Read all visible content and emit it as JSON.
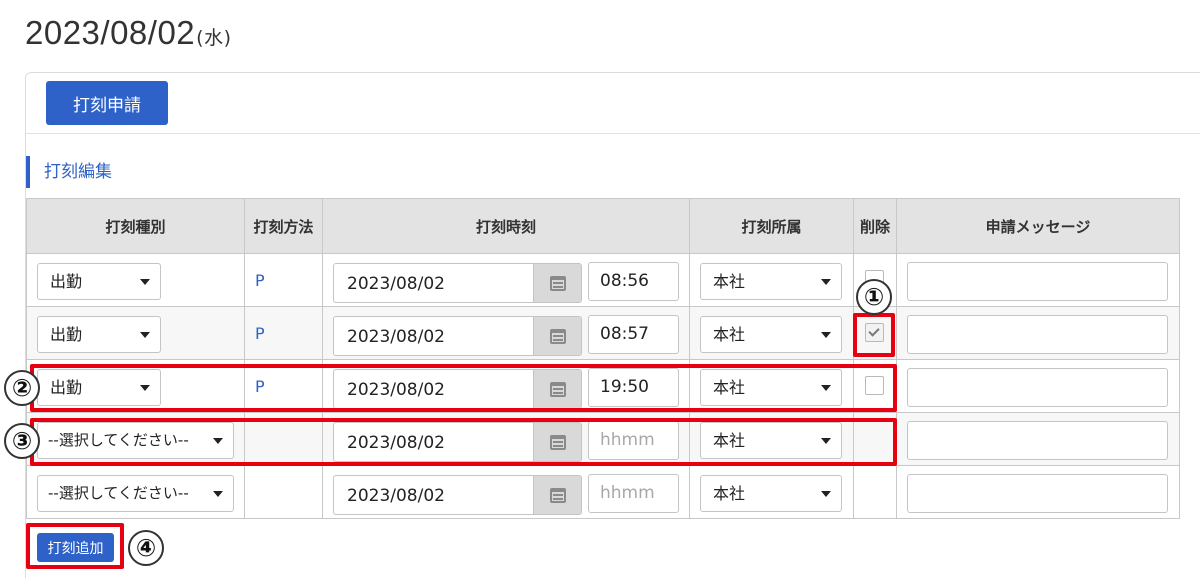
{
  "header": {
    "date": "2023/08/02",
    "day_of_week": "(水)"
  },
  "toolbar": {
    "apply_label": "打刻申請"
  },
  "section": {
    "title": "打刻編集"
  },
  "table": {
    "columns": [
      "打刻種別",
      "打刻方法",
      "打刻時刻",
      "打刻所属",
      "削除",
      "申請メッセージ"
    ],
    "rows": [
      {
        "type": "出勤",
        "method": "P",
        "date": "2023/08/02",
        "time": "08:56",
        "location": "本社",
        "deleted": false
      },
      {
        "type": "出勤",
        "method": "P",
        "date": "2023/08/02",
        "time": "08:57",
        "location": "本社",
        "deleted": true
      },
      {
        "type": "出勤",
        "method": "P",
        "date": "2023/08/02",
        "time": "19:50",
        "location": "本社",
        "deleted": false
      },
      {
        "type": "--選択してください--",
        "method": "",
        "date": "2023/08/02",
        "time_placeholder": "hhmm",
        "location": "本社"
      },
      {
        "type": "--選択してください--",
        "method": "",
        "date": "2023/08/02",
        "time_placeholder": "hhmm",
        "location": "本社"
      }
    ]
  },
  "footer": {
    "add_label": "打刻追加"
  },
  "annotations": {
    "m1": "①",
    "m2": "②",
    "m3": "③",
    "m4": "④"
  },
  "colors": {
    "accent": "#2f62c8",
    "highlight": "#e60012"
  }
}
